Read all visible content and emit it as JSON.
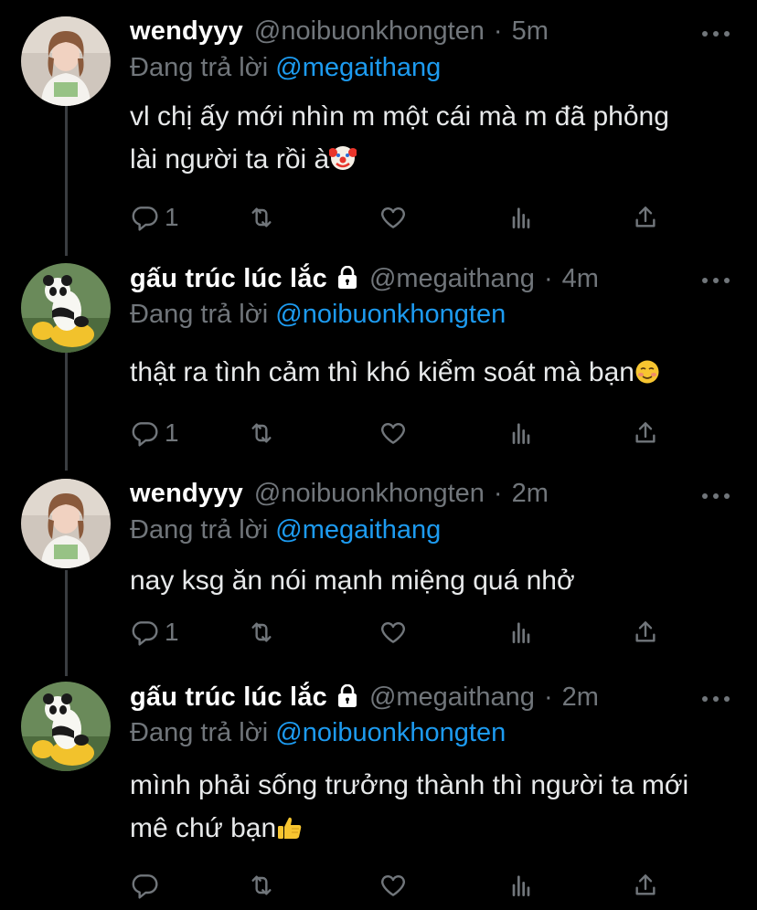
{
  "tweets": [
    {
      "name": "wendyyy",
      "handle": "@noibuonkhongten",
      "time": "5m",
      "protected": false,
      "avatar_kind": "girl",
      "reply_prefix": "Đang trả lời",
      "reply_to": "@megaithang",
      "lines": [
        "vl chị ấy mới nhìn m một cái mà m đã phỏng",
        "lài người ta rồi à"
      ],
      "trailing_emoji": "clown-face",
      "reply_count": "1"
    },
    {
      "name": "gấu trúc lúc lắc",
      "handle": "@megaithang",
      "time": "4m",
      "protected": true,
      "avatar_kind": "panda",
      "reply_prefix": "Đang trả lời",
      "reply_to": "@noibuonkhongten",
      "lines": [
        "thật ra tình cảm thì khó kiểm soát mà bạn"
      ],
      "trailing_emoji": "smiling-face-blush",
      "reply_count": "1"
    },
    {
      "name": "wendyyy",
      "handle": "@noibuonkhongten",
      "time": "2m",
      "protected": false,
      "avatar_kind": "girl",
      "reply_prefix": "Đang trả lời",
      "reply_to": "@megaithang",
      "lines": [
        "nay ksg ăn nói mạnh miệng quá nhở"
      ],
      "trailing_emoji": "",
      "reply_count": "1"
    },
    {
      "name": "gấu trúc lúc lắc",
      "handle": "@megaithang",
      "time": "2m",
      "protected": true,
      "avatar_kind": "panda",
      "reply_prefix": "Đang trả lời",
      "reply_to": "@noibuonkhongten",
      "lines": [
        "mình phải sống trưởng thành thì người ta mới",
        "mê chứ bạn"
      ],
      "trailing_emoji": "thumbs-up",
      "reply_count": ""
    }
  ],
  "separator": "·",
  "icons": {
    "reply": "reply-icon",
    "retweet": "retweet-icon",
    "like": "like-icon",
    "views": "analytics-icon",
    "share": "share-icon",
    "more": "more-icon",
    "lock": "lock-icon"
  },
  "colors": {
    "background": "#000000",
    "text": "#e7e9ea",
    "secondary": "#71767b",
    "link": "#1d9bf0",
    "thread_line": "#3a3d41"
  }
}
